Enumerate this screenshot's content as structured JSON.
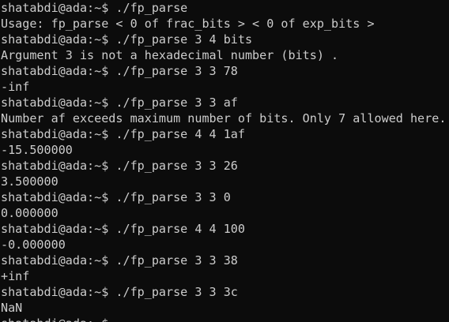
{
  "terminal": {
    "lines": [
      "shatabdi@ada:~$ ./fp_parse",
      "Usage: fp_parse < 0 of frac_bits > < 0 of exp_bits >",
      "shatabdi@ada:~$ ./fp_parse 3 4 bits",
      "Argument 3 is not a hexadecimal number (bits) .",
      "shatabdi@ada:~$ ./fp_parse 3 3 78",
      "-inf",
      "shatabdi@ada:~$ ./fp_parse 3 3 af",
      "Number af exceeds maximum number of bits. Only 7 allowed here.",
      "shatabdi@ada:~$ ./fp_parse 4 4 1af",
      "-15.500000",
      "shatabdi@ada:~$ ./fp_parse 3 3 26",
      "3.500000",
      "shatabdi@ada:~$ ./fp_parse 3 3 0",
      "0.000000",
      "shatabdi@ada:~$ ./fp_parse 4 4 100",
      "-0.000000",
      "shatabdi@ada:~$ ./fp_parse 3 3 38",
      "+inf",
      "shatabdi@ada:~$ ./fp_parse 3 3 3c",
      "NaN",
      "shatabdi@ada:~$"
    ]
  }
}
